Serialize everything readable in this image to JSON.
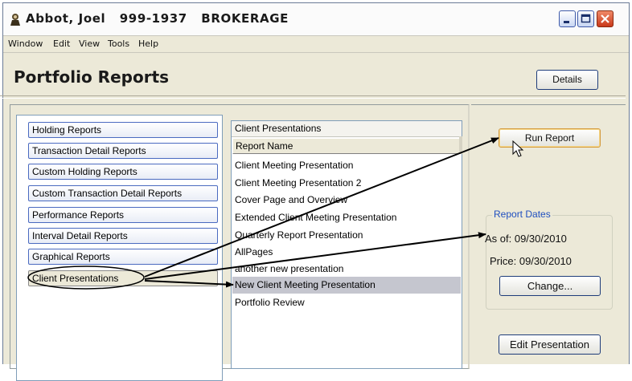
{
  "window": {
    "title": "Abbot, Joel   999-1937   BROKERAGE"
  },
  "menubar": {
    "items": [
      "Window",
      "Edit",
      "View",
      "Tools",
      "Help"
    ]
  },
  "page": {
    "title": "Portfolio Reports",
    "details_label": "Details"
  },
  "report_categories": [
    {
      "label": "Holding Reports"
    },
    {
      "label": "Transaction Detail Reports"
    },
    {
      "label": "Custom Holding Reports"
    },
    {
      "label": "Custom Transaction Detail Reports"
    },
    {
      "label": "Performance Reports"
    },
    {
      "label": "Interval Detail Reports"
    },
    {
      "label": "Graphical Reports"
    },
    {
      "label": "Client Presentations",
      "selected": true
    }
  ],
  "report_list": {
    "group_title": "Client Presentations",
    "column_header": "Report Name",
    "rows": [
      {
        "name": "Client Meeting Presentation"
      },
      {
        "name": "Client Meeting Presentation 2"
      },
      {
        "name": "Cover Page and Overview"
      },
      {
        "name": "Extended Client Meeting Presentation"
      },
      {
        "name": "Quarterly Report Presentation"
      },
      {
        "name": "AllPages"
      },
      {
        "name": "another new presentation"
      },
      {
        "name": "New Client Meeting Presentation",
        "selected": true
      },
      {
        "name": "Portfolio Review"
      }
    ]
  },
  "actions": {
    "run_report_label": "Run Report",
    "change_label": "Change...",
    "edit_presentation_label": "Edit Presentation"
  },
  "report_dates": {
    "legend": "Report Dates",
    "as_of": "As of:  09/30/2010",
    "price": "Price:  09/30/2010"
  },
  "colors": {
    "window_bg": "#ece9d8",
    "button_border": "#1e3c7a",
    "legend_blue": "#1f4fbf",
    "selected_row": "#c5c6cf",
    "close_button": "#c8381a"
  }
}
